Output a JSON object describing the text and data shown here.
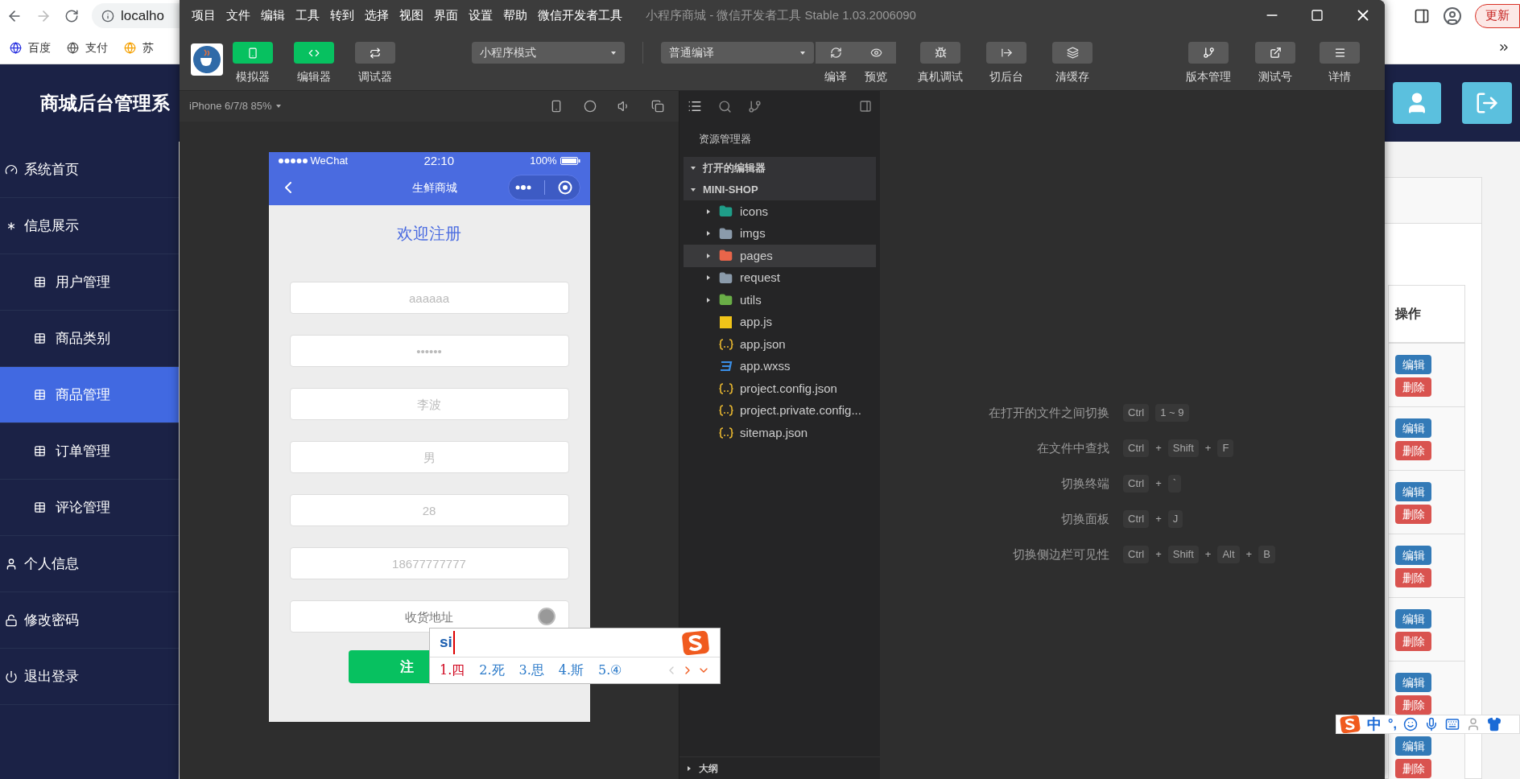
{
  "browser": {
    "address": "localho",
    "bookmarks": [
      {
        "label": "百度"
      },
      {
        "label": "支付"
      },
      {
        "label": "苏"
      }
    ],
    "update_button": "更新"
  },
  "admin": {
    "title": "商城后台管理系",
    "sidebar": {
      "items": [
        {
          "label": "系统首页",
          "selected": false
        },
        {
          "label": "信息展示",
          "selected": false,
          "children": [
            {
              "label": "用户管理",
              "selected": false
            },
            {
              "label": "商品类别",
              "selected": false
            },
            {
              "label": "商品管理",
              "selected": true
            },
            {
              "label": "订单管理",
              "selected": false
            },
            {
              "label": "评论管理",
              "selected": false
            }
          ]
        },
        {
          "label": "个人信息",
          "selected": false
        },
        {
          "label": "修改密码",
          "selected": false
        },
        {
          "label": "退出登录",
          "selected": false
        }
      ]
    },
    "table": {
      "header": "操作",
      "rows": [
        {
          "edit": "编辑",
          "delete": "删除"
        },
        {
          "edit": "编辑",
          "delete": "删除"
        },
        {
          "edit": "编辑",
          "delete": "删除"
        },
        {
          "edit": "编辑",
          "delete": "删除"
        },
        {
          "edit": "编辑",
          "delete": "删除"
        },
        {
          "edit": "编辑",
          "delete": "删除"
        },
        {
          "edit": "编辑",
          "delete": "删除"
        }
      ]
    }
  },
  "devtools": {
    "menu": [
      "项目",
      "文件",
      "编辑",
      "工具",
      "转到",
      "选择",
      "视图",
      "界面",
      "设置",
      "帮助",
      "微信开发者工具"
    ],
    "title": "小程序商城 - 微信开发者工具 Stable 1.03.2006090",
    "view_toggles": [
      {
        "label": "模拟器",
        "selected": true
      },
      {
        "label": "编辑器",
        "selected": true
      },
      {
        "label": "调试器",
        "selected": false
      }
    ],
    "mode_select": "小程序模式",
    "compile_select": "普通编译",
    "actions": [
      {
        "label": "编译"
      },
      {
        "label": "预览"
      },
      {
        "label": "真机调试"
      },
      {
        "label": "切后台"
      },
      {
        "label": "清缓存"
      }
    ],
    "right_actions": [
      {
        "label": "版本管理"
      },
      {
        "label": "测试号"
      },
      {
        "label": "详情"
      }
    ],
    "simulator": {
      "device": "iPhone 6/7/8 85%",
      "phone": {
        "carrier": "WeChat",
        "time": "22:10",
        "battery": "100%",
        "nav_title": "生鲜商城",
        "heading": "欢迎注册",
        "fields": [
          {
            "placeholder": "aaaaaa",
            "focused": false
          },
          {
            "placeholder": "••••••",
            "focused": false
          },
          {
            "placeholder": "李波",
            "focused": false
          },
          {
            "placeholder": "男",
            "focused": false
          },
          {
            "placeholder": "28",
            "focused": false
          },
          {
            "placeholder": "18677777777",
            "focused": false
          },
          {
            "placeholder": "收货地址",
            "focused": true
          }
        ],
        "submit": "注"
      }
    },
    "ime": {
      "input": "si",
      "candidates": [
        {
          "label": "1.四",
          "selected": true
        },
        {
          "label": "2.死",
          "selected": false
        },
        {
          "label": "3.思",
          "selected": false
        },
        {
          "label": "4.斯",
          "selected": false
        },
        {
          "label": "5.④",
          "selected": false
        }
      ]
    },
    "explorer": {
      "title": "资源管理器",
      "sections": [
        {
          "label": "打开的编辑器",
          "expanded": true
        },
        {
          "label": "MINI-SHOP",
          "expanded": true
        }
      ],
      "tree": [
        {
          "name": "icons",
          "kind": "folder",
          "color": "#1f9e89",
          "expanded": false,
          "selected": false
        },
        {
          "name": "imgs",
          "kind": "folder",
          "color": "#8b9bab",
          "expanded": false,
          "selected": false
        },
        {
          "name": "pages",
          "kind": "folder",
          "color": "#e8654a",
          "expanded": false,
          "selected": true
        },
        {
          "name": "request",
          "kind": "folder",
          "color": "#8b9bab",
          "expanded": false,
          "selected": false
        },
        {
          "name": "utils",
          "kind": "folder",
          "color": "#6aae47",
          "expanded": false,
          "selected": false
        },
        {
          "name": "app.js",
          "kind": "js",
          "selected": false
        },
        {
          "name": "app.json",
          "kind": "json",
          "selected": false
        },
        {
          "name": "app.wxss",
          "kind": "css",
          "selected": false
        },
        {
          "name": "project.config.json",
          "kind": "json",
          "selected": false
        },
        {
          "name": "project.private.config...",
          "kind": "json",
          "selected": false
        },
        {
          "name": "sitemap.json",
          "kind": "json",
          "selected": false
        }
      ],
      "outline": "大纲"
    },
    "shortcuts": [
      {
        "label": "在打开的文件之间切换",
        "keys": [
          {
            "kind": "key",
            "text": "Ctrl"
          },
          {
            "kind": "key",
            "text": "1 ~ 9"
          }
        ]
      },
      {
        "label": "在文件中查找",
        "keys": [
          {
            "kind": "key",
            "text": "Ctrl"
          },
          {
            "kind": "sep",
            "text": "+"
          },
          {
            "kind": "key",
            "text": "Shift"
          },
          {
            "kind": "sep",
            "text": "+"
          },
          {
            "kind": "key",
            "text": "F"
          }
        ]
      },
      {
        "label": "切换终端",
        "keys": [
          {
            "kind": "key",
            "text": "Ctrl"
          },
          {
            "kind": "sep",
            "text": "+"
          },
          {
            "kind": "key",
            "text": "`"
          }
        ]
      },
      {
        "label": "切换面板",
        "keys": [
          {
            "kind": "key",
            "text": "Ctrl"
          },
          {
            "kind": "sep",
            "text": "+"
          },
          {
            "kind": "key",
            "text": "J"
          }
        ]
      },
      {
        "label": "切换侧边栏可见性",
        "keys": [
          {
            "kind": "key",
            "text": "Ctrl"
          },
          {
            "kind": "sep",
            "text": "+"
          },
          {
            "kind": "key",
            "text": "Shift"
          },
          {
            "kind": "sep",
            "text": "+"
          },
          {
            "kind": "key",
            "text": "Alt"
          },
          {
            "kind": "sep",
            "text": "+"
          },
          {
            "kind": "key",
            "text": "B"
          }
        ]
      }
    ]
  },
  "sogou_bar": {
    "mode": "中",
    "punctuation": "°,"
  }
}
